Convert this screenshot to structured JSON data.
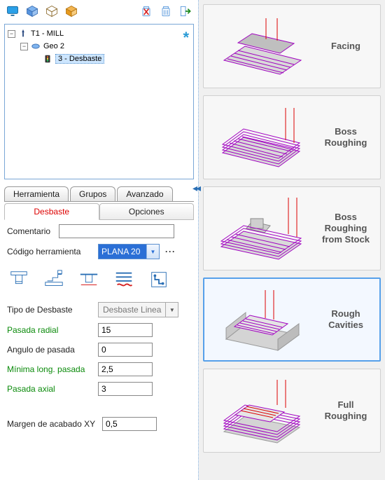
{
  "toolbar": {},
  "tree": {
    "root": "T1 - MILL",
    "geo": "Geo 2",
    "op": "3 - Desbaste"
  },
  "tabs1": {
    "herramienta": "Herramienta",
    "grupos": "Grupos",
    "avanzado": "Avanzado"
  },
  "tabs2": {
    "desbaste": "Desbaste",
    "opciones": "Opciones"
  },
  "form": {
    "comentario_label": "Comentario",
    "comentario_value": "",
    "codigo_label": "Código herramienta",
    "codigo_value": "PLANA 20",
    "tipo_label": "Tipo de Desbaste",
    "tipo_value": "Desbaste Linea",
    "pasada_radial_label": "Pasada radial",
    "pasada_radial_value": "15",
    "angulo_label": "Angulo de pasada",
    "angulo_value": "0",
    "min_long_label": "Mínima long. pasada",
    "min_long_value": "2,5",
    "pasada_axial_label": "Pasada axial",
    "pasada_axial_value": "3",
    "margen_xy_label": "Margen de acabado XY",
    "margen_xy_value": "0,5"
  },
  "ops": {
    "facing": "Facing",
    "boss_roughing": "Boss Roughing",
    "boss_roughing_stock": "Boss Roughing from Stock",
    "rough_cavities": "Rough Cavities",
    "full_roughing": "Full Roughing"
  }
}
